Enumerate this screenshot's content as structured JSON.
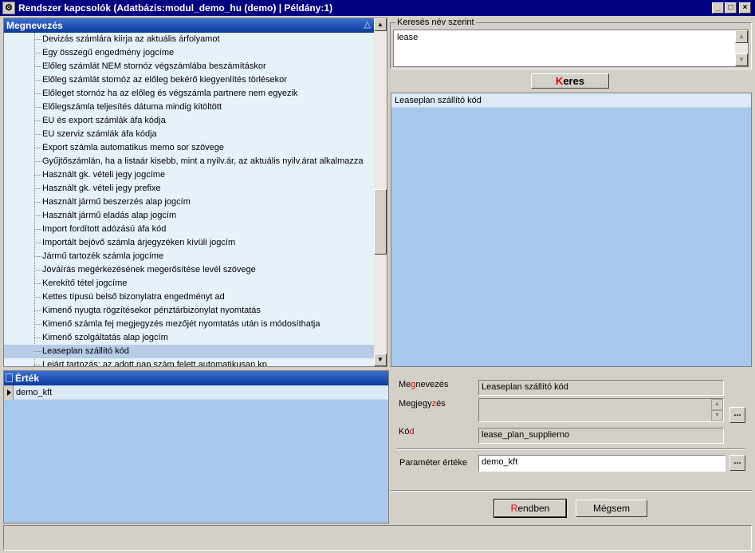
{
  "window": {
    "title": "Rendszer kapcsolók  (Adatbázis:modul_demo_hu (demo) | Példány:1)",
    "icon": "app-icon",
    "minimize": "_",
    "maximize": "□",
    "close": "×"
  },
  "tree": {
    "header": "Megnevezés",
    "sort_glyph": "△",
    "items": [
      "Devizás számlára kiírja az aktuális árfolyamot",
      "Egy összegű engedmény jogcíme",
      "Előleg számlát NEM stornóz végszámlába beszámításkor",
      "Előleg számlát stornóz az előleg bekérő kiegyenlítés törlésekor",
      "Előleget stornóz ha az előleg és végszámla partnere nem egyezik",
      "Előlegszámla teljesítés dátuma mindig kitöltött",
      "EU és export számlák áfa kódja",
      "EU szerviz számlák áfa kódja",
      "Export számla automatikus memo sor szövege",
      "Gyűjtőszámlán, ha a listaár kisebb, mint a nyilv.ár, az aktuális nyilv.árat alkalmazza",
      "Használt gk. vételi jegy jogcíme",
      "Használt gk. vételi jegy prefixe",
      "Használt jármű beszerzés alap jogcím",
      "Használt jármű eladás alap jogcím",
      "Import fordított adózású áfa kód",
      "Importált bejövő számla árjegyzéken kívüli jogcím",
      "Jármű tartozék számla jogcíme",
      "Jóváírás megérkezésének megerősítése levél szövege",
      "Kerekítő tétel jogcíme",
      "Kettes típusú belső bizonylatra engedményt ad",
      "Kimenő nyugta rögzítésekor pénztárbizonylat nyomtatás",
      "Kimenő számla fej megjegyzés mezőjét nyomtatás után is módosíthatja",
      "Kimenő szolgáltatás alap jogcím",
      "Leaseplan szállító kód",
      "Lejárt tartozás: az adott nap szám felett automatikusan kp"
    ],
    "selected_index": 23
  },
  "search": {
    "group_label": "Keresés név szerint",
    "value": "lease",
    "button_prefix": "K",
    "button_rest": "eres",
    "results": [
      "Leaseplan szállító kód"
    ]
  },
  "grid": {
    "header": "Érték",
    "rows": [
      "demo_kft"
    ]
  },
  "form": {
    "name_label_a": "Me",
    "name_label_b": "g",
    "name_label_c": "nevezés",
    "name_value": "Leaseplan szállító kód",
    "note_label_a": "Megjegy",
    "note_label_b": "z",
    "note_label_c": "és",
    "note_value": "",
    "code_label_a": "Kó",
    "code_label_b": "d",
    "code_value": "lease_plan_supplierno",
    "param_label": "Paraméter értéke",
    "param_value": "demo_kft",
    "dots": "...",
    "ok_prefix": "R",
    "ok_rest": "endben",
    "cancel": "Mégsem"
  },
  "colors": {
    "titlebar": "#000080",
    "accent_red": "#e00000",
    "list_bg": "#e6f2fa",
    "result_bg": "#a9c8ee",
    "selection": "#b7cce9"
  }
}
